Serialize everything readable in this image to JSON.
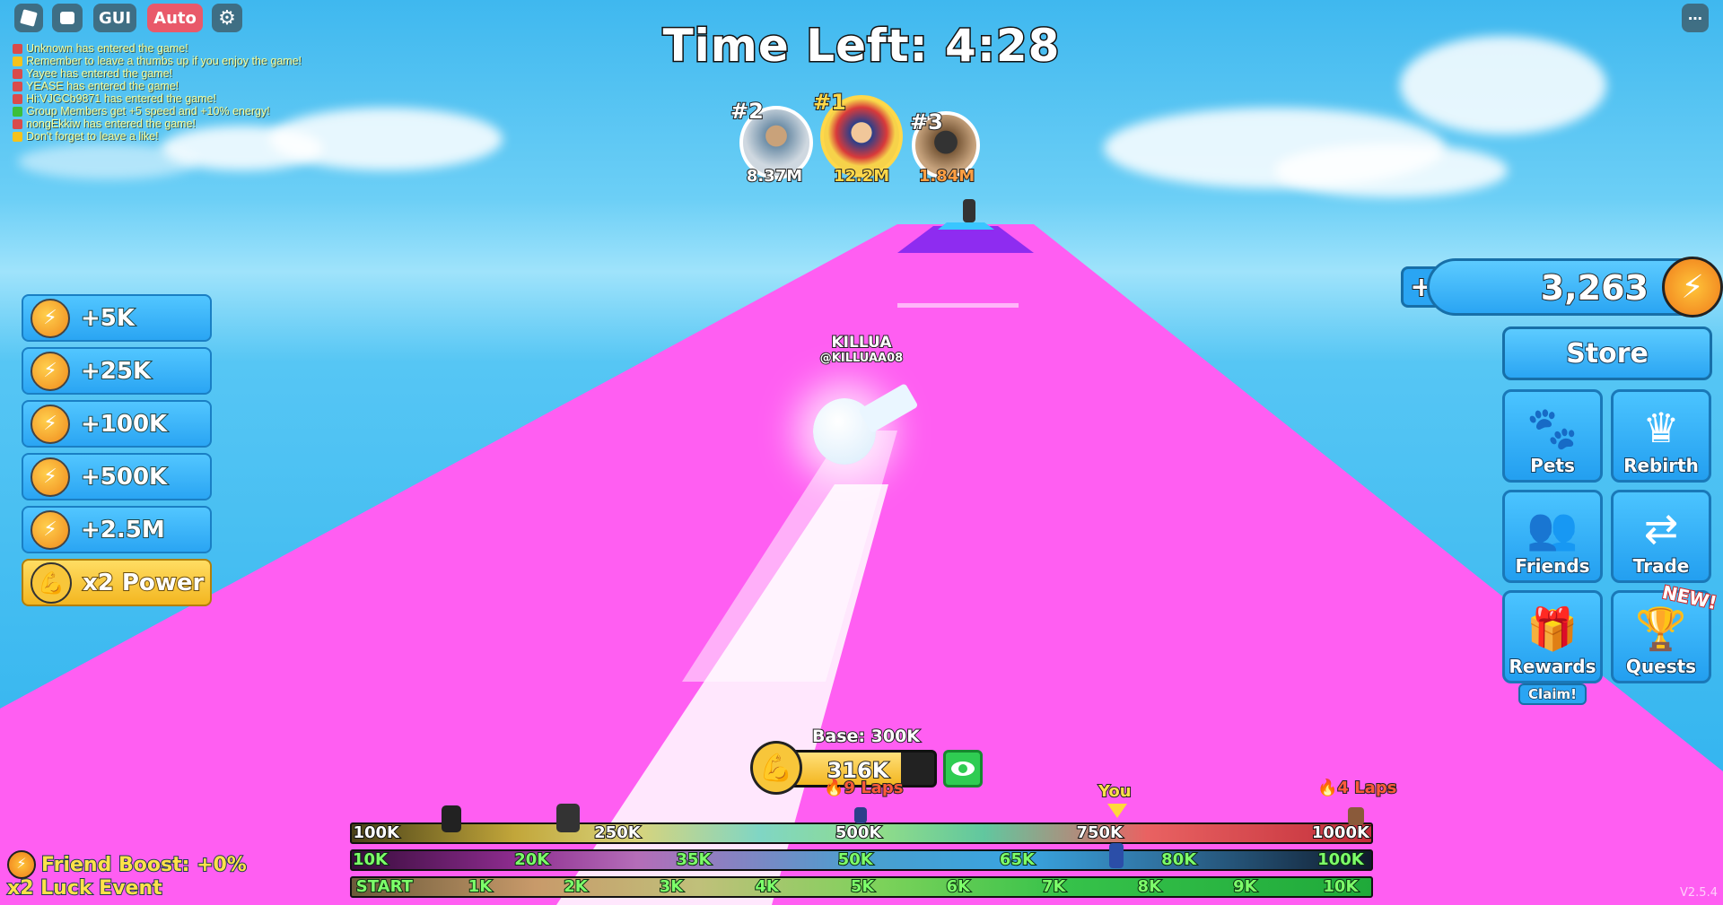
{
  "top_bar": {
    "gui_label": "GUI",
    "auto_label": "Auto"
  },
  "chat": [
    {
      "text": "Unknown has entered the game!",
      "icon": "enter",
      "color": "#d94b4b"
    },
    {
      "text": "Remember to leave a thumbs up if you enjoy the game!",
      "icon": "thumb",
      "color": "#f6c21b"
    },
    {
      "text": "Yayee has entered the game!",
      "icon": "enter",
      "color": "#d94b4b"
    },
    {
      "text": "YEASE has entered the game!",
      "icon": "enter",
      "color": "#d94b4b"
    },
    {
      "text": "Hi:VJGCb9871 has entered the game!",
      "icon": "enter",
      "color": "#d94b4b"
    },
    {
      "text": "Group Members get +5 speed and +10% energy!",
      "icon": "check",
      "color": "#3bbf3b"
    },
    {
      "text": "nongEkkiw has entered the game!",
      "icon": "enter",
      "color": "#d94b4b"
    },
    {
      "text": "Don't forget to leave a like!",
      "icon": "thumb",
      "color": "#f6c21b"
    }
  ],
  "timer": "Time Left: 4:28",
  "leaderboard": [
    {
      "rank": "#2",
      "value": "8.37M"
    },
    {
      "rank": "#1",
      "value": "12.2M"
    },
    {
      "rank": "#3",
      "value": "1.84M"
    }
  ],
  "player": {
    "display_name": "KILLUA",
    "username": "@KILLUAA08"
  },
  "boosts": [
    "+5K",
    "+25K",
    "+100K",
    "+500K",
    "+2.5M"
  ],
  "power_button": "x2 Power",
  "currency": {
    "value": "3,263",
    "plus": "+"
  },
  "right_menu": {
    "store": "Store",
    "pets": "Pets",
    "rebirth": "Rebirth",
    "friends": "Friends",
    "trade": "Trade",
    "rewards": "Rewards",
    "rewards_sub": "Claim!",
    "quests": "Quests",
    "new_badge": "NEW!"
  },
  "power_meter": {
    "base": "Base: 300K",
    "value": "316K",
    "fill_fraction": 0.78
  },
  "laps": {
    "left": "9 Laps",
    "right": "4 Laps"
  },
  "you_label": "You",
  "bars": {
    "top": [
      "100K",
      "250K",
      "500K",
      "750K",
      "1000K"
    ],
    "middle": [
      "10K",
      "20K",
      "35K",
      "50K",
      "65K",
      "80K",
      "100K"
    ],
    "bottom": [
      "START",
      "1K",
      "2K",
      "3K",
      "4K",
      "5K",
      "6K",
      "7K",
      "8K",
      "9K",
      "10K"
    ]
  },
  "friend_boost": "Friend Boost: +0%",
  "luck_event": "x2 Luck Event",
  "version": "V2.5.4",
  "colors": {
    "track": "#ff5ef2",
    "sky": "#3fb8ef",
    "boost_blue": "#2aa5f3",
    "power_gold": "#f3b620"
  }
}
